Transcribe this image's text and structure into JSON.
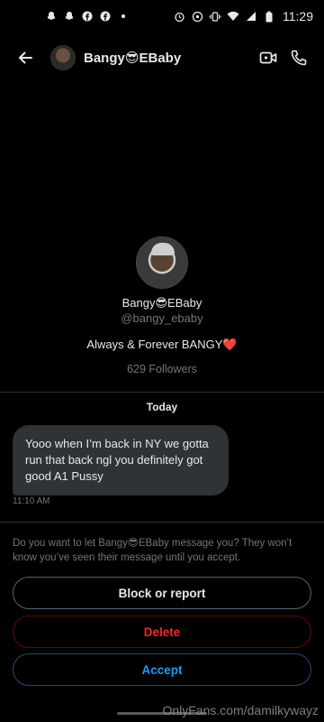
{
  "status_bar": {
    "time": "11:29",
    "left_icons": [
      "snapchat-icon",
      "snapchat-icon",
      "facebook-icon",
      "facebook-icon",
      "dot-icon"
    ],
    "right_icons": [
      "alarm-icon",
      "data-saver-icon",
      "vibrate-icon",
      "wifi-icon",
      "signal-icon",
      "battery-icon"
    ]
  },
  "header": {
    "title": "Bangy😎EBaby",
    "back_icon": "arrow-left-icon",
    "video_icon": "video-call-icon",
    "call_icon": "phone-icon"
  },
  "profile": {
    "name": "Bangy😎EBaby",
    "handle": "@bangy_ebaby",
    "bio": "Always & Forever BANGY❤️",
    "followers": "629 Followers"
  },
  "conversation": {
    "date_label": "Today",
    "message_text": "Yooo when I’m back in NY we gotta run that back ngl you definitely got good A1 Pussy",
    "message_time": "11:10 AM"
  },
  "request": {
    "prompt": "Do you want to let Bangy😎EBaby message you? They won’t know you’ve seen their message until you accept.",
    "block_label": "Block or report",
    "delete_label": "Delete",
    "accept_label": "Accept"
  },
  "watermark": "OnlyFans.com/damilkywayz",
  "colors": {
    "background": "#000000",
    "bubble": "#2f3336",
    "muted_text": "#71767b",
    "delete_red": "#f4212e",
    "accept_blue": "#1d9bf0"
  }
}
